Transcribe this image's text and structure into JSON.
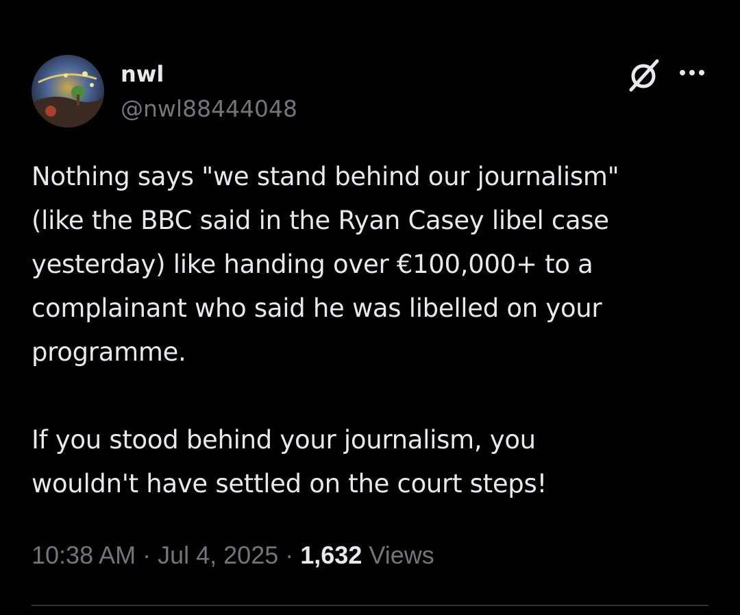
{
  "user": {
    "display_name": "nwl",
    "handle": "@nwl88444048",
    "avatar_icon": "avatar-image"
  },
  "header": {
    "grok_icon": "grok-icon",
    "more_icon": "more-icon"
  },
  "tweet": {
    "text": "Nothing says \"we stand behind our journalism\"\n(like the BBC said in the Ryan Casey libel case\nyesterday) like handing over €100,000+ to a\ncomplainant who said he was libelled on your\nprogramme.\n\nIf you stood behind your journalism, you\nwouldn't have settled on the court steps!"
  },
  "meta": {
    "time": "10:38 AM",
    "separator1": " · ",
    "date": "Jul 4, 2025",
    "separator2": " · ",
    "views_count": "1,632",
    "views_label": " Views"
  },
  "colors": {
    "background": "#000000",
    "primary_text": "#e7e9ea",
    "secondary_text": "#71767b",
    "divider": "#2f3336"
  }
}
